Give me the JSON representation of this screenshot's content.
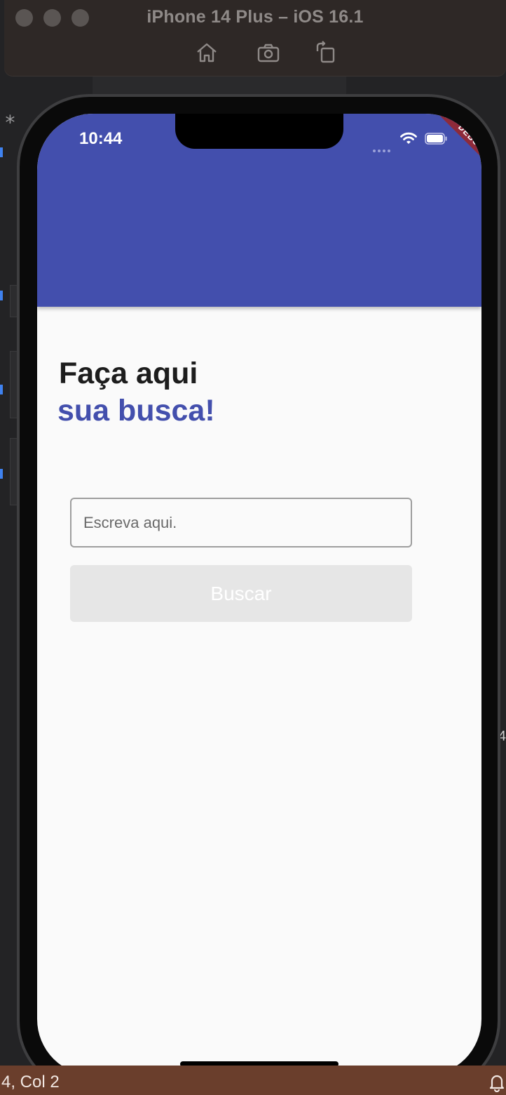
{
  "simulator": {
    "title": "iPhone 14 Plus – iOS 16.1",
    "tools": [
      "home-icon",
      "screenshot-icon",
      "rotate-icon"
    ]
  },
  "ide": {
    "status_text": "4, Col 2",
    "right_fragment": "4"
  },
  "status_bar": {
    "time": "10:44"
  },
  "debug_banner": "DEBUG",
  "heading": {
    "line1": "Faça aqui",
    "line2": "sua busca!"
  },
  "search": {
    "placeholder": "Escreva aqui.",
    "value": ""
  },
  "button": {
    "label": "Buscar"
  },
  "colors": {
    "primary": "#434fad",
    "button_disabled": "#e6e6e6",
    "debug": "#8e2a3a"
  }
}
